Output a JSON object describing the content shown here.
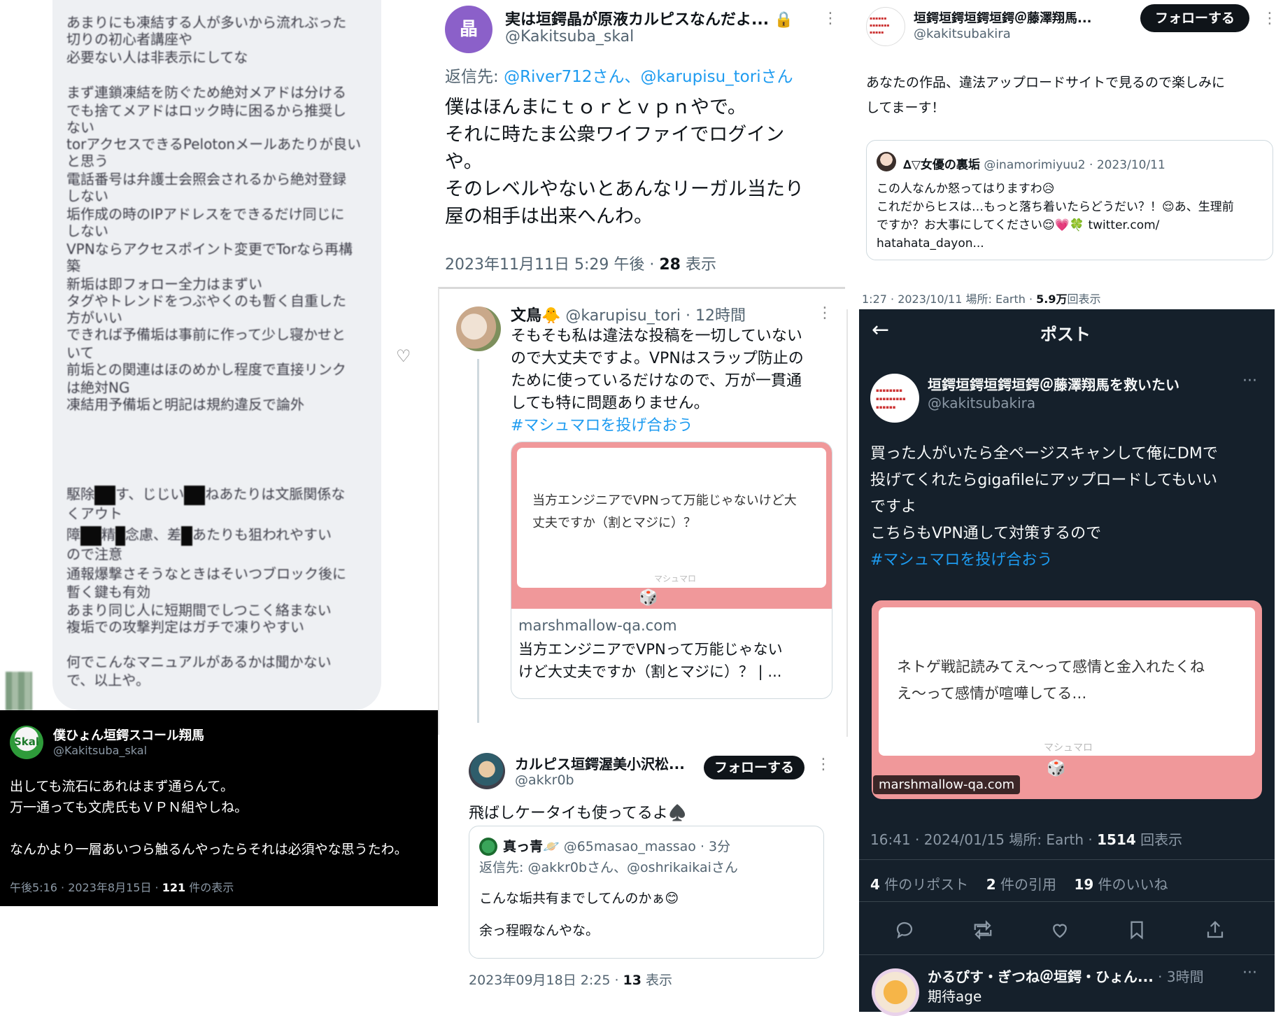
{
  "notes": {
    "lines": [
      "あまりにも凍結する人が多いから流れぶった",
      "切りの初心者講座や",
      "必要ない人は非表示にしてな",
      "まず連鎖凍結を防ぐため絶対メアドは分ける",
      "でも捨てメアドはロック時に困るから推奨し",
      "ない",
      "torアクセスできるPelotonメールあたりが良い",
      "と思う",
      "電話番号は弁護士会照会されるから絶対登録",
      "しない",
      "垢作成の時のIPアドレスをできるだけ同じに",
      "しない",
      "VPNならアクセスポイント変更でTorなら再構",
      "築",
      "新垢は即フォロー全力はまずい",
      "タグやトレンドをつぶやくのも暫く自重した",
      "方がいい",
      "できれば予備垢は事前に作って少し寝かせと",
      "いて",
      "前垢との関連はほのめかし程度で直接リンク",
      "は絶対NG",
      "凍結用予備垢と明記は規約違反で論外"
    ],
    "redacted_lines": {
      "r1a": "駆除",
      "r1b": "す、じじい",
      "r1c": "ねあたりは文脈関係な",
      "r2": "くアウト",
      "r3a": "障",
      "r3b": "精",
      "r3c": "念慮、差",
      "r3d": "あたりも狙われやすい",
      "r4": "ので注意"
    },
    "tail_lines": [
      "通報爆撃さそうなときはそいつブロック後に",
      "暫く鍵も有効",
      "あまり同じ人に短期間でしつこく絡まない",
      "複垢での攻撃判定はガチで凍りやすい",
      "何でこんなマニュアルがあるかは聞かない",
      "で、以上や。"
    ]
  },
  "dark_tweet": {
    "display_name": "僕ひょん垣鍔スコール翔馬",
    "handle": "@Kakitsuba_skal",
    "avatar_text": "Skal",
    "body": [
      "出しても流石にあれはまず通らんて。",
      "万一通っても文虎氏もＶＰＮ組やしね。",
      "",
      "なんかより一層あいつら触るんやったらそれは必須やな思うたわ。"
    ],
    "time": "午後5:16 · 2023年8月15日 · ",
    "views_count": "121",
    "views_label": " 件の表示"
  },
  "mid_tweet": {
    "avatar_text": "晶",
    "display_name": "実は垣鍔晶が原液カルピスなんだよ...",
    "lock_icon": "🔒",
    "handle": "@Kakitsuba_skal",
    "reply_to_label": "返信先: ",
    "reply_to": "@River712さん、@karupisu_toriさん",
    "body": [
      "僕はほんまにｔｏｒとｖｐｎやで。",
      "それに時たま公衆ワイファイでログイン",
      "や。",
      "そのレベルやないとあんなリーガル当たり",
      "屋の相手は出来へんわ。"
    ],
    "time": "2023年11月11日 5:29 午後 · ",
    "views_count": "28",
    "views_label": " 表示"
  },
  "karupisu_reply": {
    "display_name": "文鳥🐥",
    "handle": "@karupisu_tori",
    "time": " · 12時間",
    "body": [
      "そもそも私は違法な投稿を一切していない",
      "ので大丈夫ですよ。VPNはスラップ防止の",
      "ために使っているだけなので、万が一貫通",
      "しても特に問題ありません。"
    ],
    "hashtag": "#マシュマロを投げ合おう",
    "card": {
      "question": [
        "当方エンジニアでVPNって万能じゃないけど大",
        "丈夫ですか（割とマジに）？"
      ],
      "brand": "マシュマロ",
      "domain": "marshmallow-qa.com",
      "title": [
        "当方エンジニアでVPNって万能じゃない",
        "けど大丈夫ですか（割とマジに）？ | ..."
      ]
    }
  },
  "calpis_tweet": {
    "display_name": "カルピス垣鍔渥美小沢松...",
    "handle": "@akkr0b",
    "follow_label": "フォローする",
    "body": "飛ばしケータイも使ってるよ♠️",
    "quote": {
      "display_name": "真っ青🪐",
      "handle": "@65masao_massao",
      "time": " · 3分",
      "reply_to": "返信先: @akkr0bさん、@oshrikaikaiさん",
      "line1": "こんな垢共有までしてんのかぁ😊",
      "line2": "余っ程暇なんやな。"
    },
    "time": "2023年09月18日 2:25 · ",
    "views_count": "13",
    "views_label": " 表示"
  },
  "right_tweet": {
    "display_name": "垣鍔垣鍔垣鍔垣鍔＠藤澤翔馬...",
    "handle": "@kakitsubakira",
    "follow_label": "フォローする",
    "body": [
      "あなたの作品、違法アップロードサイトで見るので楽しみに",
      "してまーす！"
    ],
    "quote": {
      "display_name": "∆▽女優の裏垢",
      "handle": "@inamorimiyuu2",
      "date": " · 2023/10/11",
      "lines": [
        "この人なんか怒ってはりますわ😥",
        "これだからヒスは…もっと落ち着いたらどうだい？！😌あ、生理前",
        "ですか？お大事にしてください😌💗🍀 twitter.com/",
        "hatahata_dayon..."
      ]
    },
    "meta_time": "1:27 · 2023/10/11  場所: Earth · ",
    "meta_views": "5.9万",
    "meta_views_label": "回表示"
  },
  "post_view": {
    "back_icon": "←",
    "title": "ポスト",
    "display_name": "垣鍔垣鍔垣鍔垣鍔＠藤澤翔馬を救いたい",
    "handle": "@kakitsubakira",
    "more_icon": "···",
    "body": [
      "買った人がいたら全ページスキャンして俺にDMで",
      "投げてくれたらgigafileにアップロードしてもいい",
      "ですよ",
      "こちらもVPN通して対策するので"
    ],
    "hashtag": "#マシュマロを投げ合おう",
    "card": {
      "question": [
        "ネトゲ戦記読みてえ〜って感情と金入れたくね",
        "え〜って感情が喧嘩してる…"
      ],
      "brand": "マシュマロ",
      "domain": "marshmallow-qa.com"
    },
    "time": "16:41 · 2024/01/15  場所: Earth · ",
    "views_count": "1514",
    "views_label": " 回表示",
    "stats": {
      "reposts_count": "4",
      "reposts_label": " 件のリポスト",
      "quotes_count": "2",
      "quotes_label": " 件の引用",
      "likes_count": "19",
      "likes_label": " 件のいいね"
    },
    "reply": {
      "display_name": "かるぴす・ぎつね＠垣鍔・ひょん...",
      "time": " · 3時間",
      "body": "期待age"
    }
  }
}
